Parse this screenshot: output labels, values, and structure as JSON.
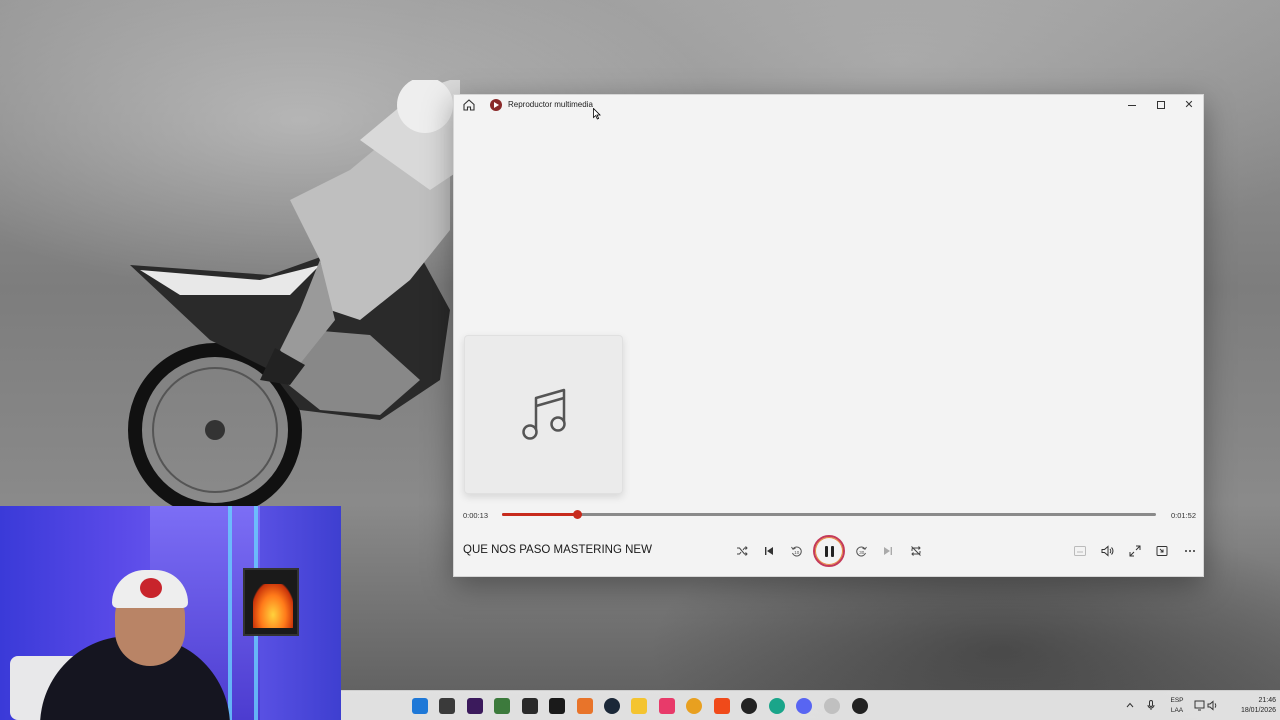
{
  "window": {
    "title": "Reproductor multimedia"
  },
  "player": {
    "current_time": "0:00:13",
    "total_time": "0:01:52",
    "progress": 0.116,
    "track_title": "QUE NOS PASO MASTERING NEW",
    "accent_color": "#c72a1c"
  },
  "controls": {
    "left": [
      "shuffle-icon",
      "previous-icon",
      "rewind-10-icon",
      "pause-icon",
      "forward-30-icon",
      "next-icon",
      "repeat-icon"
    ],
    "right": [
      "captions-icon",
      "volume-icon",
      "fullscreen-icon",
      "miniplayer-icon",
      "more-icon"
    ]
  },
  "taskbar": {
    "language": [
      "ESP",
      "LAA"
    ],
    "time": "21:46",
    "date": "18/01/2026"
  }
}
